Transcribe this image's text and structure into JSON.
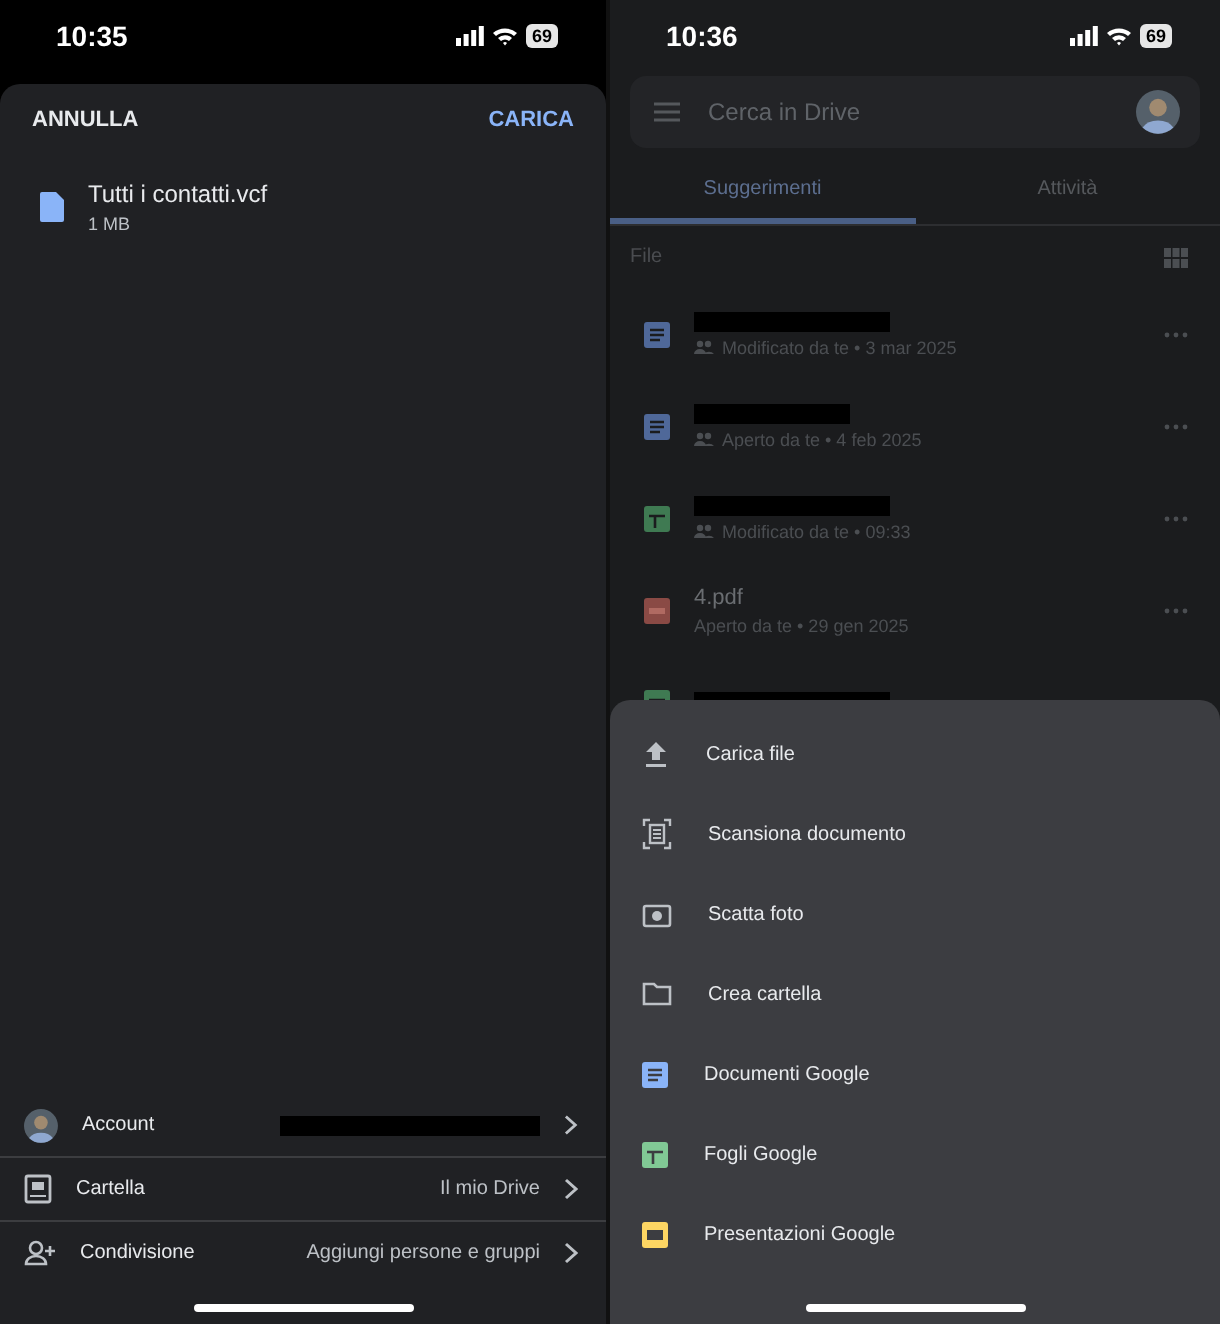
{
  "upload_screen": {
    "status_bar": {
      "time": "10:35",
      "battery": "69"
    },
    "cancel": "ANNULLA",
    "confirm": "CARICA",
    "file": {
      "name": "Tutti i contatti.vcf",
      "size": "1 MB"
    },
    "settings": [
      {
        "kind": "account",
        "label": "Account",
        "redacted": true
      },
      {
        "kind": "folder",
        "label": "Cartella",
        "value": "Il mio Drive"
      },
      {
        "kind": "share",
        "label": "Condivisione",
        "value": "Aggiungi persone e gruppi"
      }
    ]
  },
  "drive_screen": {
    "status_bar": {
      "time": "10:36",
      "battery": "69"
    },
    "search": {
      "placeholder": "Cerca in Drive"
    },
    "tabs": [
      {
        "label": "Suggerimenti",
        "selected": true
      },
      {
        "label": "Attività",
        "selected": false
      }
    ],
    "section": "File",
    "files": [
      {
        "kind": "doc",
        "redacted": true,
        "shared": true,
        "detail": "Modificato da te • 3 mar 2025"
      },
      {
        "kind": "doc",
        "redacted": true,
        "shared": true,
        "detail": "Aperto da te • 4 feb 2025"
      },
      {
        "kind": "sheet",
        "redacted": true,
        "shared": true,
        "detail": "Modificato da te • 09:33"
      },
      {
        "kind": "pdf",
        "redacted": false,
        "shared": false,
        "name": "4.pdf",
        "detail": "Aperto da te • 29 gen 2025"
      },
      {
        "kind": "sheet",
        "redacted": true
      }
    ],
    "menu": [
      {
        "kind": "upload",
        "label": "Carica file"
      },
      {
        "kind": "scan",
        "label": "Scansiona documento"
      },
      {
        "kind": "camera",
        "label": "Scatta foto"
      },
      {
        "kind": "folder",
        "label": "Crea cartella"
      },
      {
        "kind": "docs",
        "label": "Documenti Google"
      },
      {
        "kind": "sheets",
        "label": "Fogli Google"
      },
      {
        "kind": "slides",
        "label": "Presentazioni Google"
      }
    ]
  }
}
